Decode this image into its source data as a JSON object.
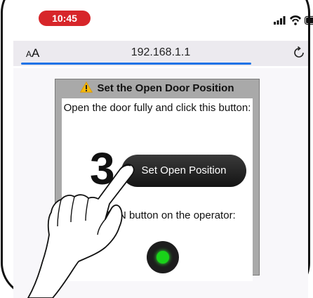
{
  "status_bar": {
    "time": "10:45"
  },
  "browser": {
    "text_size_button": {
      "small": "A",
      "large": "A"
    },
    "url": "192.168.1.1",
    "reload_icon": "reload-icon",
    "load_progress": 0.78
  },
  "card": {
    "header_icon": "warning-icon",
    "title": "Set the Open Door Position",
    "instruction_1": "Open the door fully and click this button:",
    "step_number": "3",
    "button_label": "Set Open Position",
    "instruction_2": "the OPEN button on the operator:",
    "led_color": "#19d319"
  },
  "colors": {
    "time_pill": "#d7262a",
    "progress": "#1e73e6",
    "card_frame": "#a9a9a9"
  }
}
